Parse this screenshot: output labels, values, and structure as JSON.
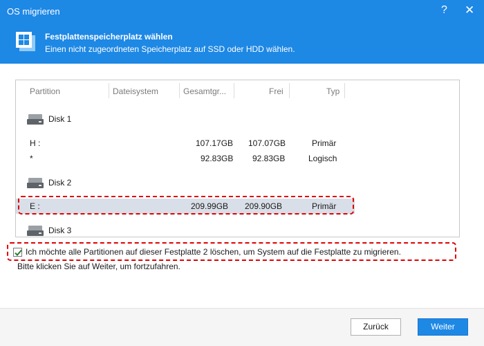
{
  "window": {
    "title": "OS migrieren",
    "help_label": "?",
    "close_label": "✕"
  },
  "header": {
    "title": "Festplattenspeicherplatz wählen",
    "subtitle": "Einen nicht zugeordneten Speicherplatz auf SSD oder HDD wählen."
  },
  "table": {
    "columns": [
      "Partition",
      "Dateisystem",
      "Gesamtgr...",
      "Frei",
      "Typ"
    ],
    "disks": [
      {
        "label": "Disk 1",
        "partitions": [
          {
            "partition": "H :",
            "filesystem": "",
            "total": "107.17GB",
            "free": "107.07GB",
            "type": "Primär"
          },
          {
            "partition": "*",
            "filesystem": "",
            "total": "92.83GB",
            "free": "92.83GB",
            "type": "Logisch"
          }
        ]
      },
      {
        "label": "Disk 2",
        "partitions": [
          {
            "partition": "E :",
            "filesystem": "",
            "total": "209.99GB",
            "free": "209.90GB",
            "type": "Primär"
          }
        ]
      },
      {
        "label": "Disk 3",
        "partitions": []
      }
    ]
  },
  "confirm": {
    "checked": true,
    "label": "Ich möchte alle Partitionen auf dieser Festplatte 2 löschen, um System auf die Festplatte zu migrieren."
  },
  "hint": "Bitte klicken Sie auf Weiter, um fortzufahren.",
  "buttons": {
    "back": "Zurück",
    "next": "Weiter"
  },
  "colors": {
    "accent": "#1e88e5",
    "highlight": "#e00000",
    "selected_row": "#d9dfe8"
  }
}
